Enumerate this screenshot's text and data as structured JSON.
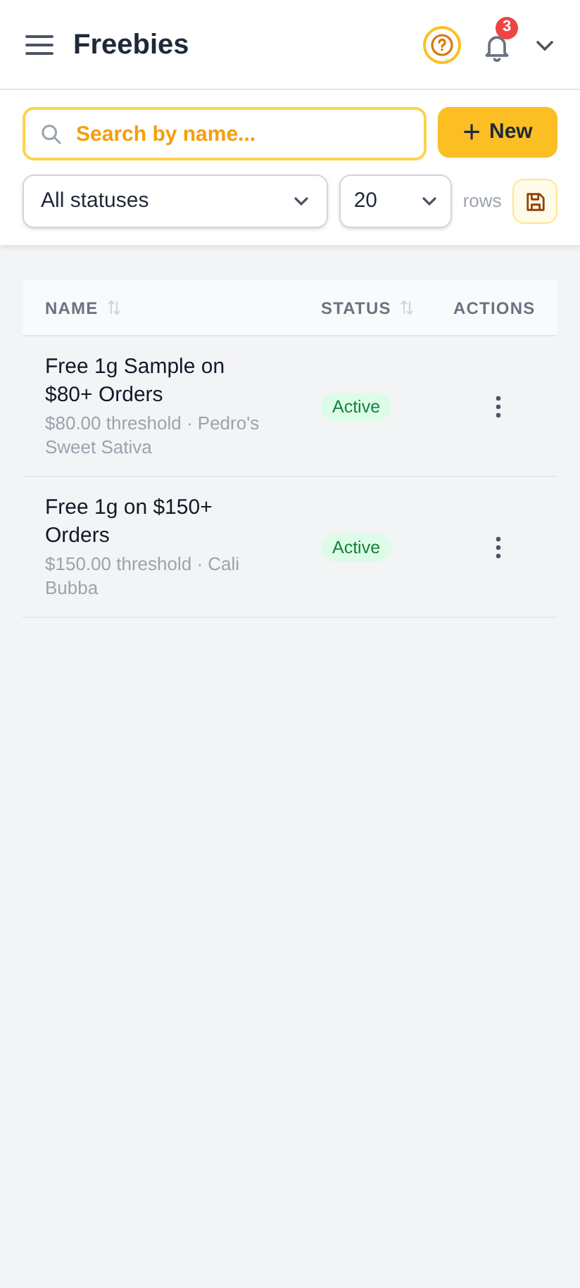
{
  "header": {
    "title": "Freebies",
    "notification_count": "3"
  },
  "toolbar": {
    "search": {
      "placeholder": "Search by name..."
    },
    "new_button": {
      "icon": "+",
      "label": "New"
    },
    "status_filter": {
      "value": "All statuses"
    },
    "page_size": {
      "value": "20"
    },
    "rows_label": "rows"
  },
  "table": {
    "columns": [
      {
        "label": "NAME",
        "sortable": true
      },
      {
        "label": "STATUS",
        "sortable": true
      },
      {
        "label": "ACTIONS"
      }
    ],
    "rows": [
      {
        "name": "Free 1g Sample on $80+ Orders",
        "detail": "$80.00 threshold · Pedro's Sweet Sativa",
        "status": "Active"
      },
      {
        "name": "Free 1g on $150+ Orders",
        "detail": "$150.00 threshold · Cali Bubba",
        "status": "Active"
      }
    ]
  }
}
